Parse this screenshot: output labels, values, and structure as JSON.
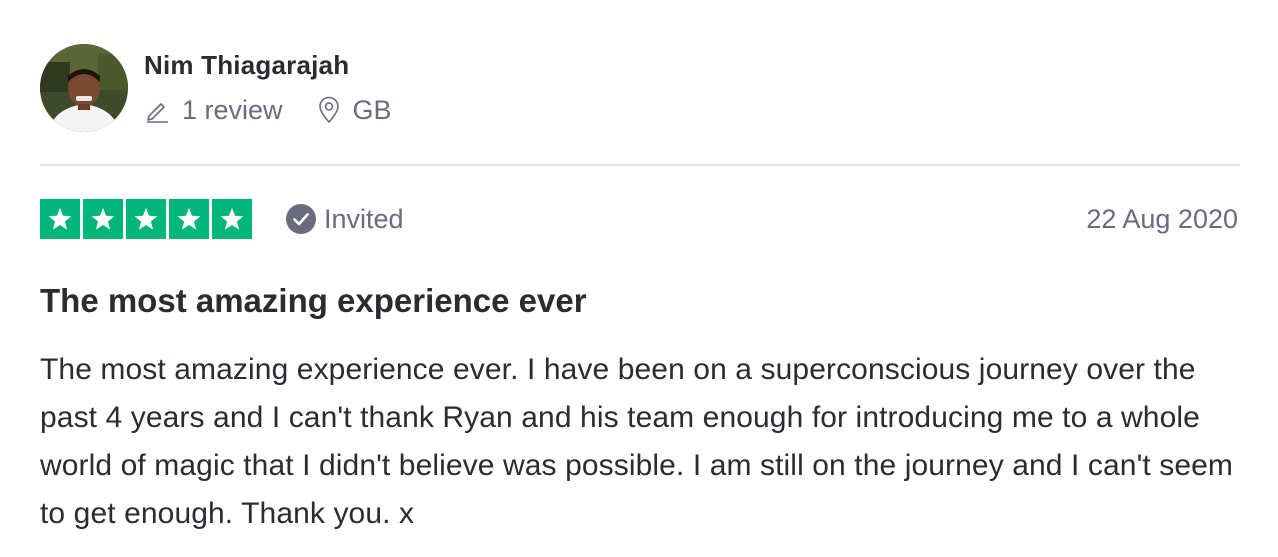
{
  "reviewer": {
    "name": "Nim Thiagarajah",
    "review_count": "1 review",
    "country": "GB",
    "icons": {
      "review_count": "pencil-icon",
      "country": "location-pin-icon"
    }
  },
  "review": {
    "rating": 5,
    "rating_max": 5,
    "invited_label": "Invited",
    "date": "22 Aug 2020",
    "title": "The most amazing experience ever",
    "body": "The most amazing experience ever. I have been on a superconscious journey over the past 4 years and I can't thank Ryan and his team enough for introducing me to a whole world of magic that I didn't believe was possible. I am still on the journey and I can't seem to get enough. Thank you. x"
  },
  "colors": {
    "star_fill": "#00b67a",
    "star_empty": "#dcdce6",
    "muted_text": "#6b6b80",
    "heading_text": "#2b2b33",
    "divider": "#e5e5dd",
    "invited_badge": "#6b6b80"
  }
}
